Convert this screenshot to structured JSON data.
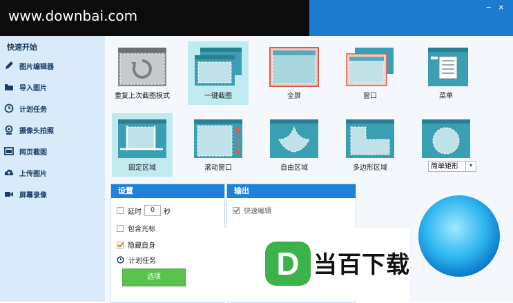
{
  "watermark": "www.downbai.com",
  "window": {
    "minimize": "−",
    "close": "×"
  },
  "sidebar": {
    "heading": "快速开始",
    "items": [
      {
        "label": "图片编辑器",
        "icon": "pencil-icon"
      },
      {
        "label": "导入图片",
        "icon": "folder-icon"
      },
      {
        "label": "计划任务",
        "icon": "clock-icon"
      },
      {
        "label": "摄像头拍照",
        "icon": "webcam-icon"
      },
      {
        "label": "网页截图",
        "icon": "webpage-icon"
      },
      {
        "label": "上传图片",
        "icon": "cloud-upload-icon"
      },
      {
        "label": "屏幕录像",
        "icon": "video-camera-icon"
      }
    ]
  },
  "modes": [
    {
      "label": "重复上次截图模式",
      "icon": "repeat-capture-icon"
    },
    {
      "label": "一键截图",
      "icon": "one-click-capture-icon",
      "selected": true
    },
    {
      "label": "全屏",
      "icon": "fullscreen-capture-icon"
    },
    {
      "label": "窗口",
      "icon": "window-capture-icon"
    },
    {
      "label": "菜单",
      "icon": "menu-capture-icon"
    },
    {
      "label": "固定区域",
      "icon": "fixed-region-icon",
      "selected": true
    },
    {
      "label": "滚动窗口",
      "icon": "scrolling-window-icon"
    },
    {
      "label": "自由区域",
      "icon": "freehand-region-icon"
    },
    {
      "label": "多边形区域",
      "icon": "polygon-region-icon"
    },
    {
      "label": "",
      "icon": "shape-region-icon"
    }
  ],
  "shape_select": {
    "value": "简单矩形"
  },
  "settings": {
    "title": "设置",
    "delay_label": "延时",
    "delay_value": "0",
    "delay_unit": "秒",
    "include_cursor": "包含光标",
    "hide_self": "隐藏自身",
    "schedule": "计划任务",
    "options_button": "选项"
  },
  "output": {
    "title": "输出",
    "quick_edit": "快速编辑"
  },
  "brand": {
    "text": "当百下载",
    "letter": "D"
  },
  "colors": {
    "accent": "#1e82d8",
    "sidebar_bg": "#d9ebfa",
    "selected_tile": "#bfeaf0",
    "button_green": "#5cc24f"
  }
}
